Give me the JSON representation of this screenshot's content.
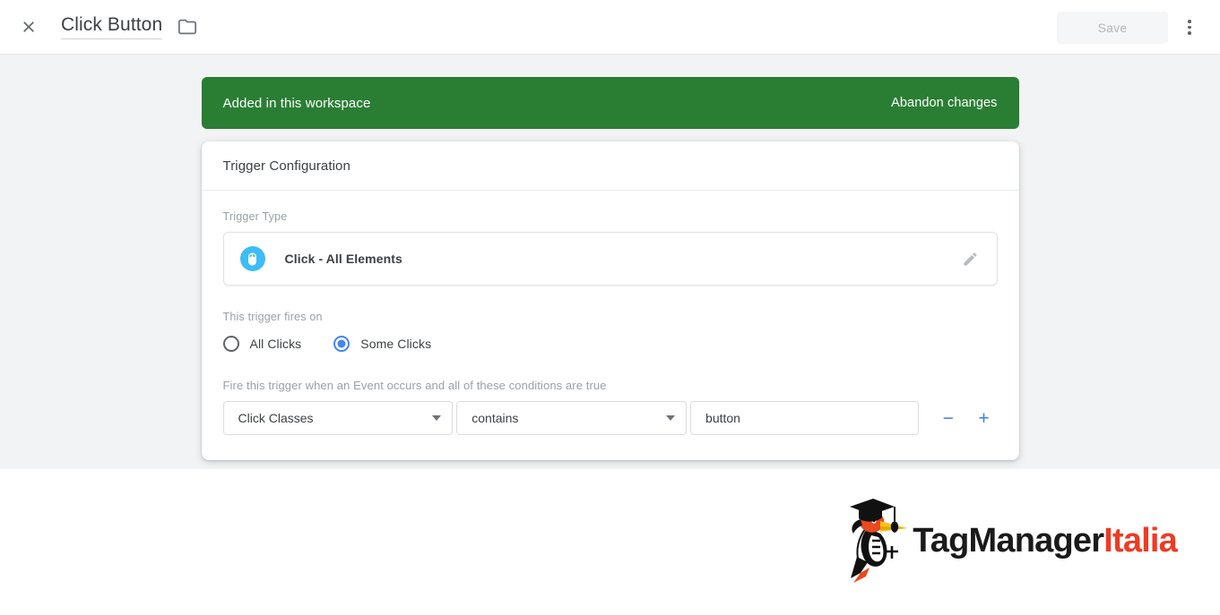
{
  "appbar": {
    "close_icon": "close-icon",
    "title": "Click Button",
    "folder_icon": "folder-icon",
    "save_label": "Save",
    "save_disabled": true,
    "more_icon": "more-vert-icon"
  },
  "banner": {
    "message": "Added in this workspace",
    "action": "Abandon changes",
    "color": "#2a7e34"
  },
  "card": {
    "header": "Trigger Configuration",
    "trigger_type": {
      "label": "Trigger Type",
      "icon": "mouse-click-icon",
      "icon_color": "#3dbcf5",
      "name": "Click - All Elements",
      "edit_icon": "pencil-edit-icon"
    },
    "fires_on": {
      "label": "This trigger fires on",
      "options": [
        {
          "label": "All Clicks",
          "selected": false
        },
        {
          "label": "Some Clicks",
          "selected": true
        }
      ],
      "accent_color": "#4285f4"
    },
    "conditions": {
      "label": "Fire this trigger when an Event occurs and all of these conditions are true",
      "rows": [
        {
          "variable": "Click Classes",
          "operator": "contains",
          "value": "button",
          "value_placeholder": "",
          "remove_label": "−",
          "add_label": "+"
        }
      ],
      "button_color": "#3d7ef0"
    }
  },
  "footer": {
    "logo": {
      "mark": "woodpecker-graduate-icon",
      "text_primary": "TagManager",
      "text_secondary": "Italia",
      "primary_color": "#1a1a1a",
      "secondary_color": "#ee3b24"
    }
  }
}
